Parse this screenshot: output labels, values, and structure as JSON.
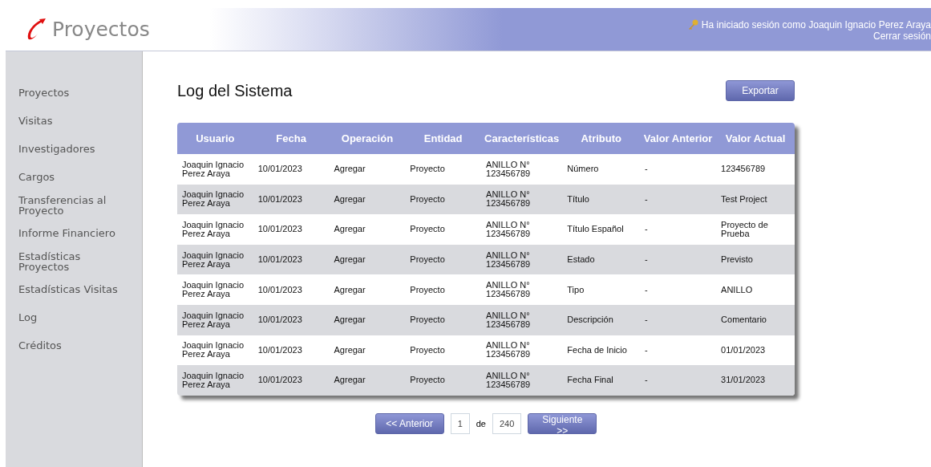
{
  "header": {
    "logo": "Proyectos",
    "session_text": "Ha iniciado sesión como Joaquin Ignacio Perez Araya",
    "logout": "Cerrar sesión"
  },
  "sidebar": {
    "items": [
      "Proyectos",
      "Visitas",
      "Investigadores",
      "Cargos",
      "Transferencias al Proyecto",
      "Informe Financiero",
      "Estadísticas Proyectos",
      "Estadísticas Visitas",
      "Log",
      "Créditos"
    ]
  },
  "page_title": "Log del Sistema",
  "export_button": "Exportar",
  "table": {
    "columns": [
      "Usuario",
      "Fecha",
      "Operación",
      "Entidad",
      "Características",
      "Atributo",
      "Valor Anterior",
      "Valor Actual"
    ],
    "rows": [
      [
        "Joaquin Ignacio Perez Araya",
        "10/01/2023",
        "Agregar",
        "Proyecto",
        "ANILLO N° 123456789",
        "Número",
        "-",
        "123456789"
      ],
      [
        "Joaquin Ignacio Perez Araya",
        "10/01/2023",
        "Agregar",
        "Proyecto",
        "ANILLO N° 123456789",
        "Título",
        "-",
        "Test Project"
      ],
      [
        "Joaquin Ignacio Perez Araya",
        "10/01/2023",
        "Agregar",
        "Proyecto",
        "ANILLO N° 123456789",
        "Título Español",
        "-",
        "Proyecto de Prueba"
      ],
      [
        "Joaquin Ignacio Perez Araya",
        "10/01/2023",
        "Agregar",
        "Proyecto",
        "ANILLO N° 123456789",
        "Estado",
        "-",
        "Previsto"
      ],
      [
        "Joaquin Ignacio Perez Araya",
        "10/01/2023",
        "Agregar",
        "Proyecto",
        "ANILLO N° 123456789",
        "Tipo",
        "-",
        "ANILLO"
      ],
      [
        "Joaquin Ignacio Perez Araya",
        "10/01/2023",
        "Agregar",
        "Proyecto",
        "ANILLO N° 123456789",
        "Descripción",
        "-",
        "Comentario"
      ],
      [
        "Joaquin Ignacio Perez Araya",
        "10/01/2023",
        "Agregar",
        "Proyecto",
        "ANILLO N° 123456789",
        "Fecha de Inicio",
        "-",
        "01/01/2023"
      ],
      [
        "Joaquin Ignacio Perez Araya",
        "10/01/2023",
        "Agregar",
        "Proyecto",
        "ANILLO N° 123456789",
        "Fecha Final",
        "-",
        "31/01/2023"
      ]
    ]
  },
  "pagination": {
    "previous": "<< Anterior",
    "page": "1",
    "of": "de",
    "total": "240",
    "next": "Siguiente >>"
  }
}
